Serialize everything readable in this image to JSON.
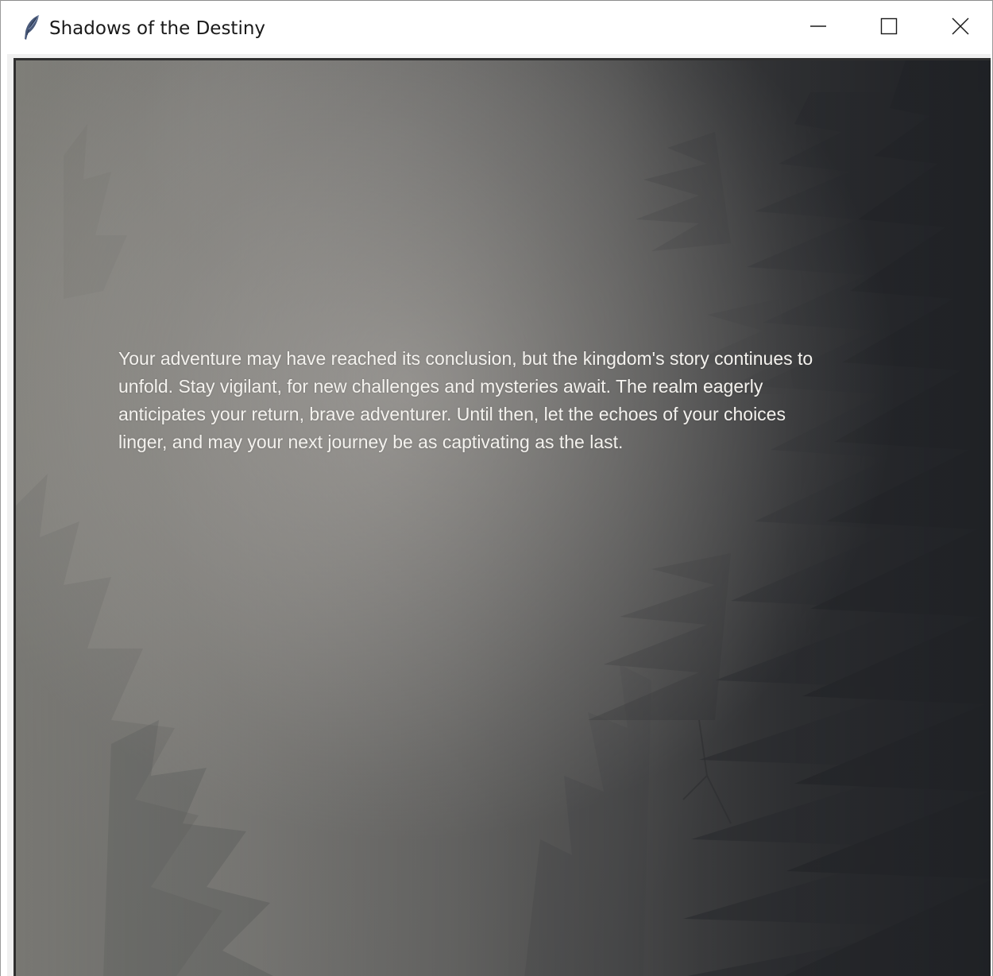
{
  "window": {
    "title": "Shadows of the Destiny",
    "icon": "feather-icon",
    "controls": {
      "minimize_icon": "minimize-icon",
      "maximize_icon": "maximize-icon",
      "close_icon": "close-icon"
    }
  },
  "scene": {
    "background": "misty-forest",
    "narration": "Your adventure may have reached its conclusion, but the kingdom's story continues to unfold. Stay vigilant, for new challenges and mysteries await. The realm eagerly anticipates your return, brave adventurer. Until then, let the echoes of your choices linger, and may your next journey be as captivating as the last."
  },
  "colors": {
    "text": "#f4f2ee",
    "titlebar": "#ffffff",
    "fog": "#a8a5a0",
    "trees": "#2c2d30"
  }
}
